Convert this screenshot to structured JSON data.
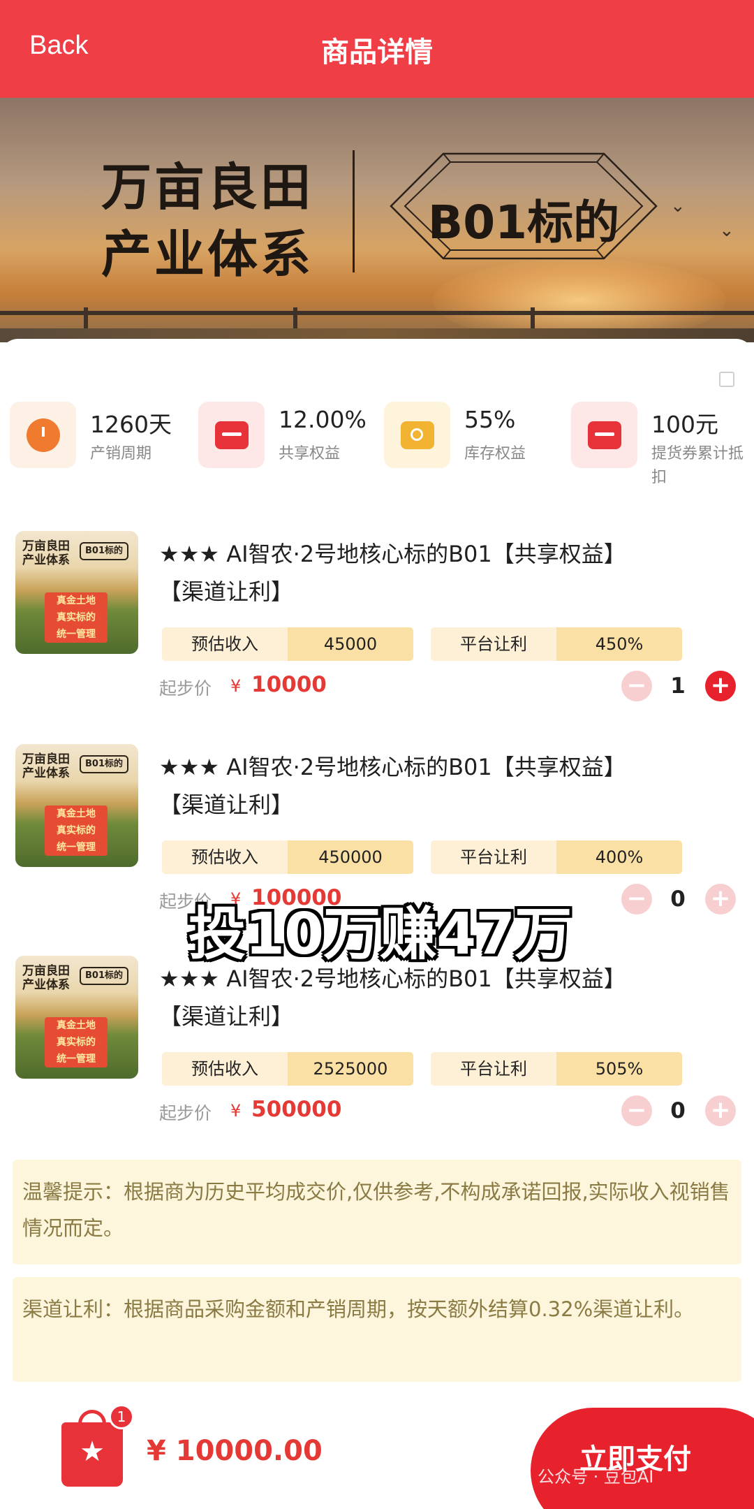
{
  "header": {
    "back_label": "Back",
    "title": "商品详情"
  },
  "banner": {
    "slogan_line1": "万亩良田",
    "slogan_line2": "产业体系",
    "badge": "B01标的"
  },
  "stats": [
    {
      "value": "1260天",
      "label": "产销周期",
      "icon": "timer-icon",
      "color": "#f07a2e"
    },
    {
      "value": "12.00%",
      "label": "共享权益",
      "icon": "wallet-icon",
      "color": "#e8323a"
    },
    {
      "value": "55%",
      "label": "库存权益",
      "icon": "search-box-icon",
      "color": "#f2b333"
    },
    {
      "value": "100元",
      "label": "提货券累计抵扣",
      "icon": "wallet-icon",
      "color": "#e8323a"
    }
  ],
  "products": [
    {
      "thumb": {
        "line1": "万亩良田",
        "line2": "产业体系",
        "tag": "B01标的",
        "stamp1": "真金土地",
        "stamp2": "真实标的",
        "stamp3": "统一管理"
      },
      "title_line1": "★★★ AI智农·2号地核心标的B01【共享权益】",
      "title_line2": "【渠道让利】",
      "income_label": "预估收入",
      "income_value": "45000",
      "discount_label": "平台让利",
      "discount_value": "450%",
      "price_label": "起步价",
      "currency": "¥",
      "price": "10000",
      "qty": "1"
    },
    {
      "thumb": {
        "line1": "万亩良田",
        "line2": "产业体系",
        "tag": "B01标的",
        "stamp1": "真金土地",
        "stamp2": "真实标的",
        "stamp3": "统一管理"
      },
      "title_line1": "★★★ AI智农·2号地核心标的B01【共享权益】",
      "title_line2": "【渠道让利】",
      "income_label": "预估收入",
      "income_value": "450000",
      "discount_label": "平台让利",
      "discount_value": "400%",
      "price_label": "起步价",
      "currency": "¥",
      "price": "100000",
      "qty": "0"
    },
    {
      "thumb": {
        "line1": "万亩良田",
        "line2": "产业体系",
        "tag": "B01标的",
        "stamp1": "真金土地",
        "stamp2": "真实标的",
        "stamp3": "统一管理"
      },
      "title_line1": "★★★ AI智农·2号地核心标的B01【共享权益】",
      "title_line2": "【渠道让利】",
      "income_label": "预估收入",
      "income_value": "2525000",
      "discount_label": "平台让利",
      "discount_value": "505%",
      "price_label": "起步价",
      "currency": "¥",
      "price": "500000",
      "qty": "0"
    }
  ],
  "overlay_caption": "投10万赚47万",
  "notices": {
    "tip": "温馨提示：根据商为历史平均成交价,仅供参考,不构成承诺回报,实际收入视销售情况而定。",
    "channel": "渠道让利：根据商品采购金额和产销周期，按天额外结算0.32%渠道让利。"
  },
  "bottom": {
    "cart_count": "1",
    "total": "¥ 10000.00",
    "pay_label": "立即支付",
    "watermark": "公众号 · 豆包AI"
  },
  "colors": {
    "brand_red": "#ef3e45",
    "accent_red": "#e8222d",
    "notice_bg": "#fdf6dc"
  }
}
